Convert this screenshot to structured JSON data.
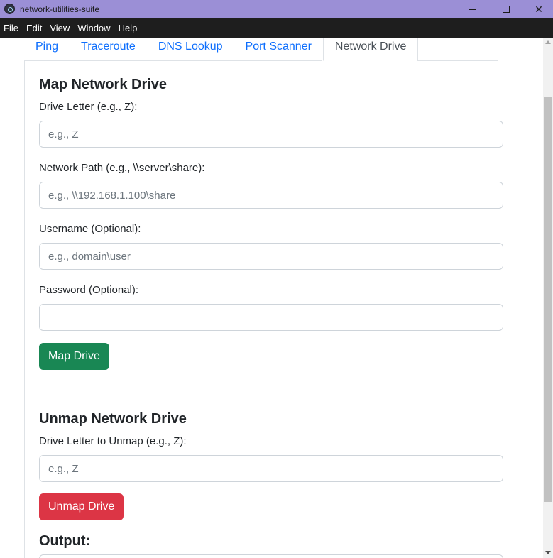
{
  "window": {
    "title": "network-utilities-suite"
  },
  "menu": [
    "File",
    "Edit",
    "View",
    "Window",
    "Help"
  ],
  "tabs": [
    {
      "label": "Ping",
      "active": false
    },
    {
      "label": "Traceroute",
      "active": false
    },
    {
      "label": "DNS Lookup",
      "active": false
    },
    {
      "label": "Port Scanner",
      "active": false
    },
    {
      "label": "Network Drive",
      "active": true
    }
  ],
  "map": {
    "heading": "Map Network Drive",
    "drive_letter_label": "Drive Letter (e.g., Z):",
    "drive_letter_placeholder": "e.g., Z",
    "path_label": "Network Path (e.g., \\\\server\\share):",
    "path_placeholder": "e.g., \\\\192.168.1.100\\share",
    "username_label": "Username (Optional):",
    "username_placeholder": "e.g., domain\\user",
    "password_label": "Password (Optional):",
    "password_placeholder": "",
    "button": "Map Drive"
  },
  "unmap": {
    "heading": "Unmap Network Drive",
    "drive_letter_label": "Drive Letter to Unmap (e.g., Z):",
    "drive_letter_placeholder": "e.g., Z",
    "button": "Unmap Drive"
  },
  "output": {
    "heading": "Output:"
  },
  "colors": {
    "titlebar": "#9b8fd6",
    "menubar": "#1e1e1e",
    "link": "#0d6efd",
    "success": "#198754",
    "danger": "#dc3545"
  }
}
